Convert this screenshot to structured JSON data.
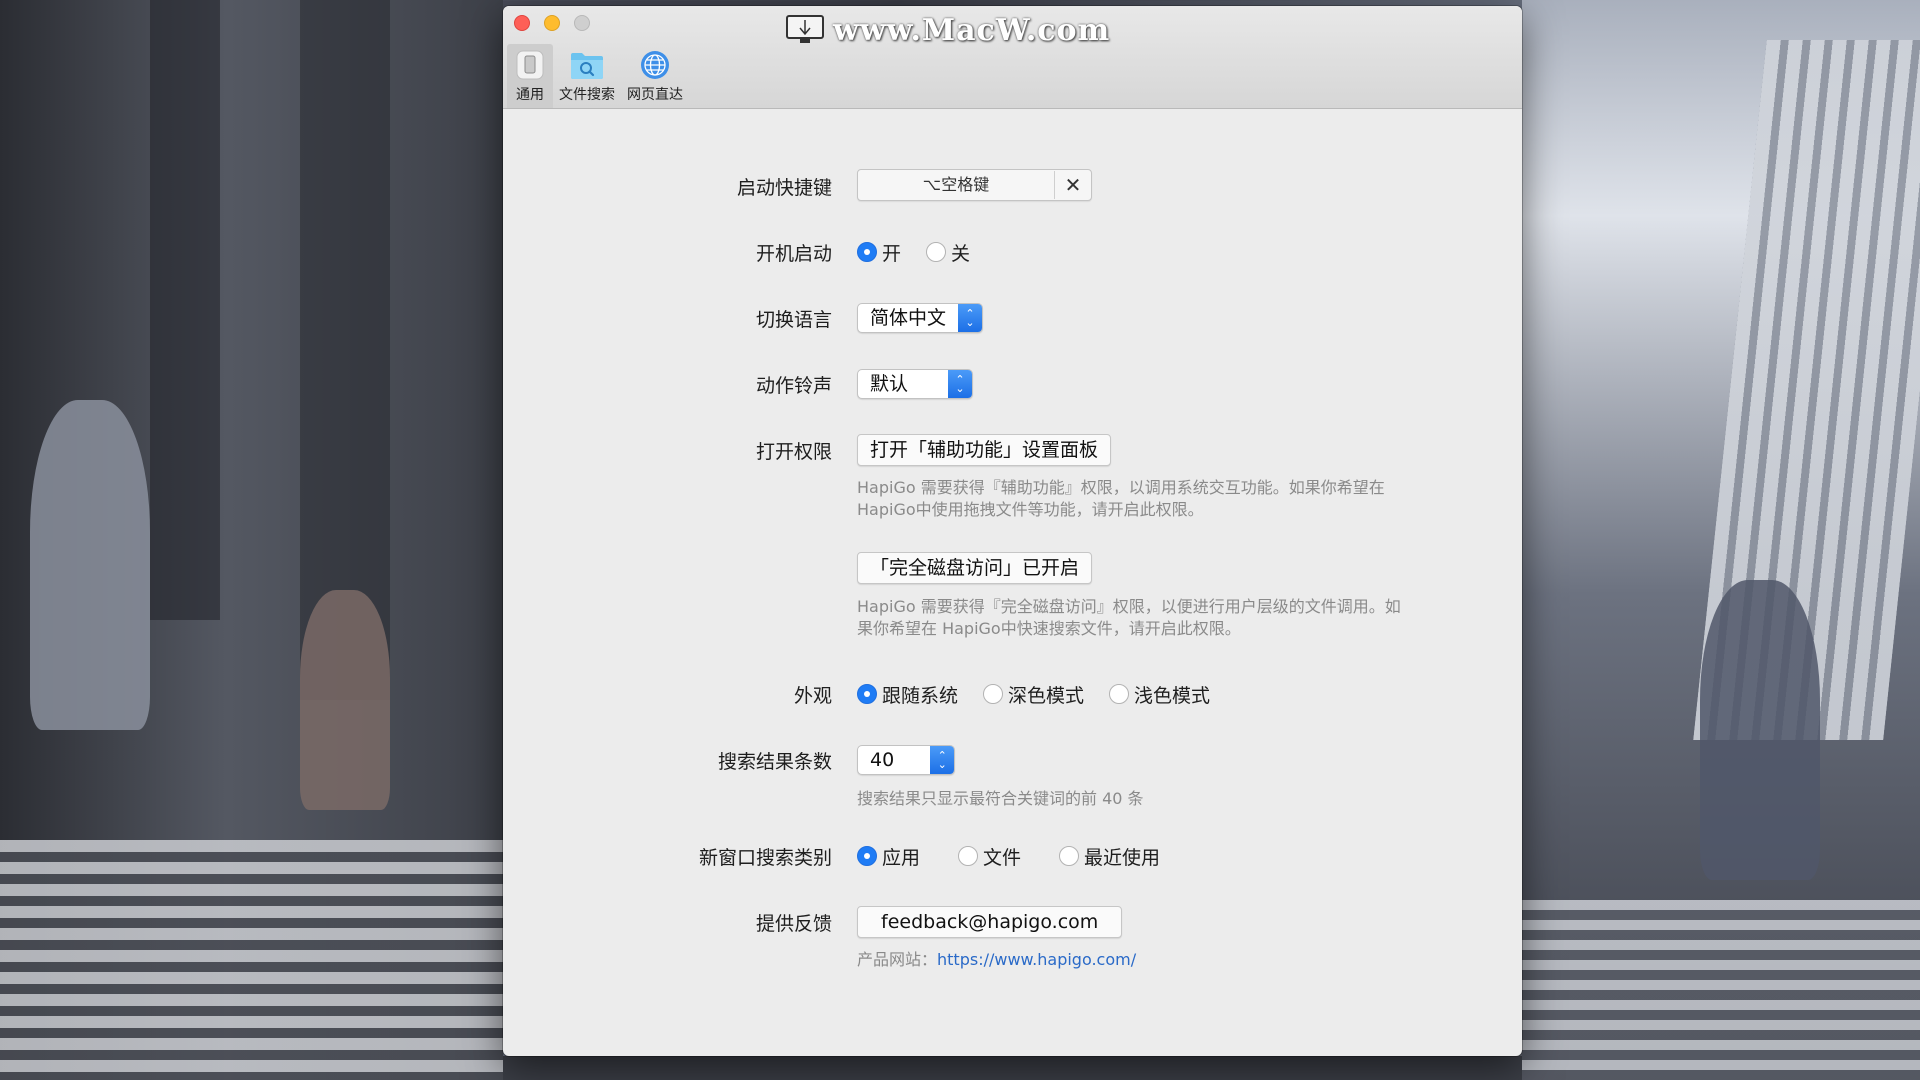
{
  "watermark": {
    "text": "www.MacW.com"
  },
  "toolbar": {
    "items": [
      {
        "label": "通用",
        "icon": "phone-icon"
      },
      {
        "label": "文件搜索",
        "icon": "folder-search-icon"
      },
      {
        "label": "网页直达",
        "icon": "globe-icon"
      }
    ],
    "selected_index": 0
  },
  "settings": {
    "shortcut": {
      "label": "启动快捷键",
      "value": "⌥空格键",
      "clear": "✕"
    },
    "launch_at_login": {
      "label": "开机启动",
      "options": [
        "开",
        "关"
      ],
      "selected": "开"
    },
    "language": {
      "label": "切换语言",
      "value": "简体中文"
    },
    "sound": {
      "label": "动作铃声",
      "value": "默认"
    },
    "permissions": {
      "label": "打开权限",
      "accessibility_button": "打开「辅助功能」设置面板",
      "accessibility_hint_1": "HapiGo 需要获得『辅助功能』权限，以调用系统交互功能。如果你希望在",
      "accessibility_hint_2": "HapiGo中使用拖拽文件等功能，请开启此权限。",
      "disk_button": "「完全磁盘访问」已开启",
      "disk_hint_1": "HapiGo 需要获得『完全磁盘访问』权限，以便进行用户层级的文件调用。如",
      "disk_hint_2": "果你希望在 HapiGo中快速搜索文件，请开启此权限。"
    },
    "appearance": {
      "label": "外观",
      "options": [
        "跟随系统",
        "深色模式",
        "浅色模式"
      ],
      "selected": "跟随系统"
    },
    "result_count": {
      "label": "搜索结果条数",
      "value": "40",
      "hint": "搜索结果只显示最符合关键词的前 40 条"
    },
    "new_window_category": {
      "label": "新窗口搜索类别",
      "options": [
        "应用",
        "文件",
        "最近使用"
      ],
      "selected": "应用"
    },
    "feedback": {
      "label": "提供反馈",
      "button": "feedback@hapigo.com",
      "site_label": "产品网站：",
      "site_url": "https://www.hapigo.com/"
    }
  },
  "colors": {
    "accent": "#1f7cf5",
    "link": "#2a6ac8",
    "window_bg": "#ececec"
  }
}
